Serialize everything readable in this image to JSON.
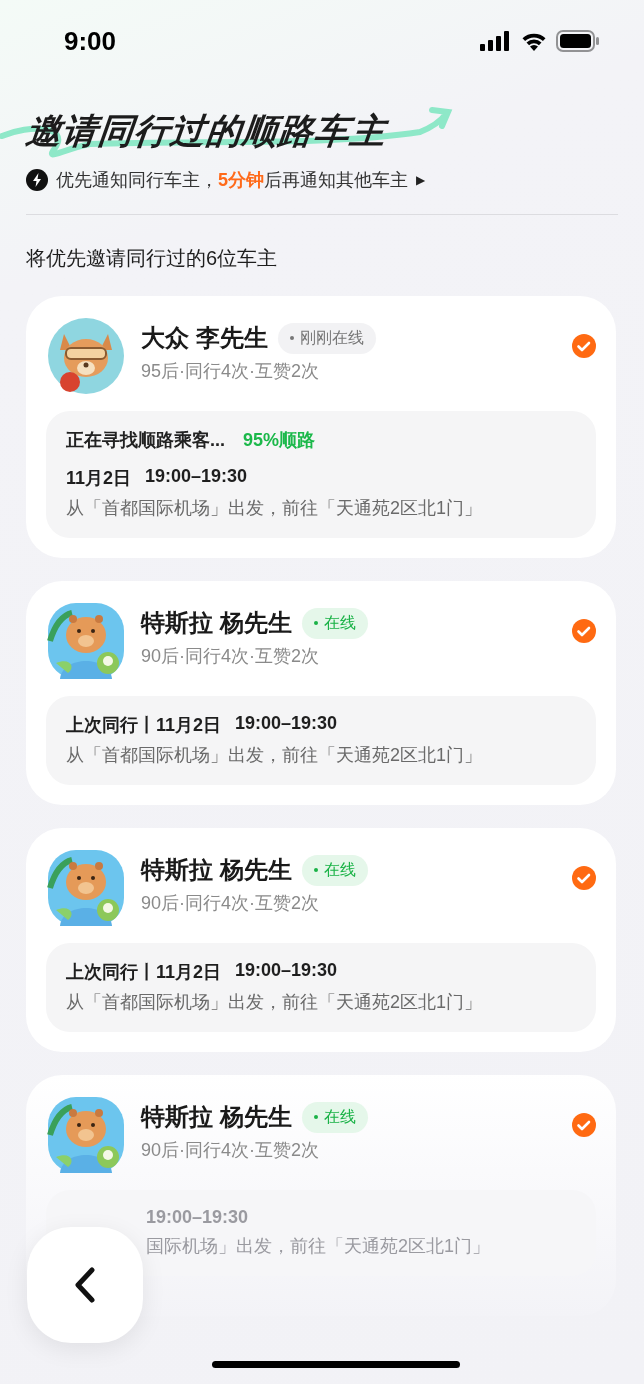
{
  "status_bar": {
    "time": "9:00"
  },
  "header": {
    "title": "邀请同行过的顺路车主",
    "notice": {
      "text": "优先通知同行车主，",
      "highlight": "5分钟",
      "rest": "后再通知其他车主",
      "arrow": "▶"
    }
  },
  "section_title": "将优先邀请同行过的6位车主",
  "drivers": [
    {
      "name": "大众 李先生",
      "status": {
        "kind": "recent",
        "label": "刚刚在线"
      },
      "meta": "95后·同行4次·互赞2次",
      "checked": true,
      "kind": "fox",
      "trip": {
        "kind": "searching",
        "label": "正在寻找顺路乘客...",
        "match": "95%顺路",
        "date": "11月2日",
        "time": "19:00–19:30",
        "route": "从「首都国际机场」出发，前往「天通苑2区北1门」"
      }
    },
    {
      "name": "特斯拉 杨先生",
      "status": {
        "kind": "online",
        "label": "在线"
      },
      "meta": "90后·同行4次·互赞2次",
      "checked": true,
      "kind": "capybara",
      "trip": {
        "kind": "last",
        "label": "上次同行丨11月2日",
        "time": "19:00–19:30",
        "route": "从「首都国际机场」出发，前往「天通苑2区北1门」"
      }
    },
    {
      "name": "特斯拉 杨先生",
      "status": {
        "kind": "online",
        "label": "在线"
      },
      "meta": "90后·同行4次·互赞2次",
      "checked": true,
      "kind": "capybara",
      "trip": {
        "kind": "last",
        "label": "上次同行丨11月2日",
        "time": "19:00–19:30",
        "route": "从「首都国际机场」出发，前往「天通苑2区北1门」"
      }
    },
    {
      "name": "特斯拉 杨先生",
      "status": {
        "kind": "online",
        "label": "在线"
      },
      "meta": "90后·同行4次·互赞2次",
      "checked": true,
      "kind": "capybara",
      "trip": {
        "kind": "partial",
        "time": "19:00–19:30",
        "route": "国际机场」出发，前往「天通苑2区北1门」"
      }
    }
  ]
}
